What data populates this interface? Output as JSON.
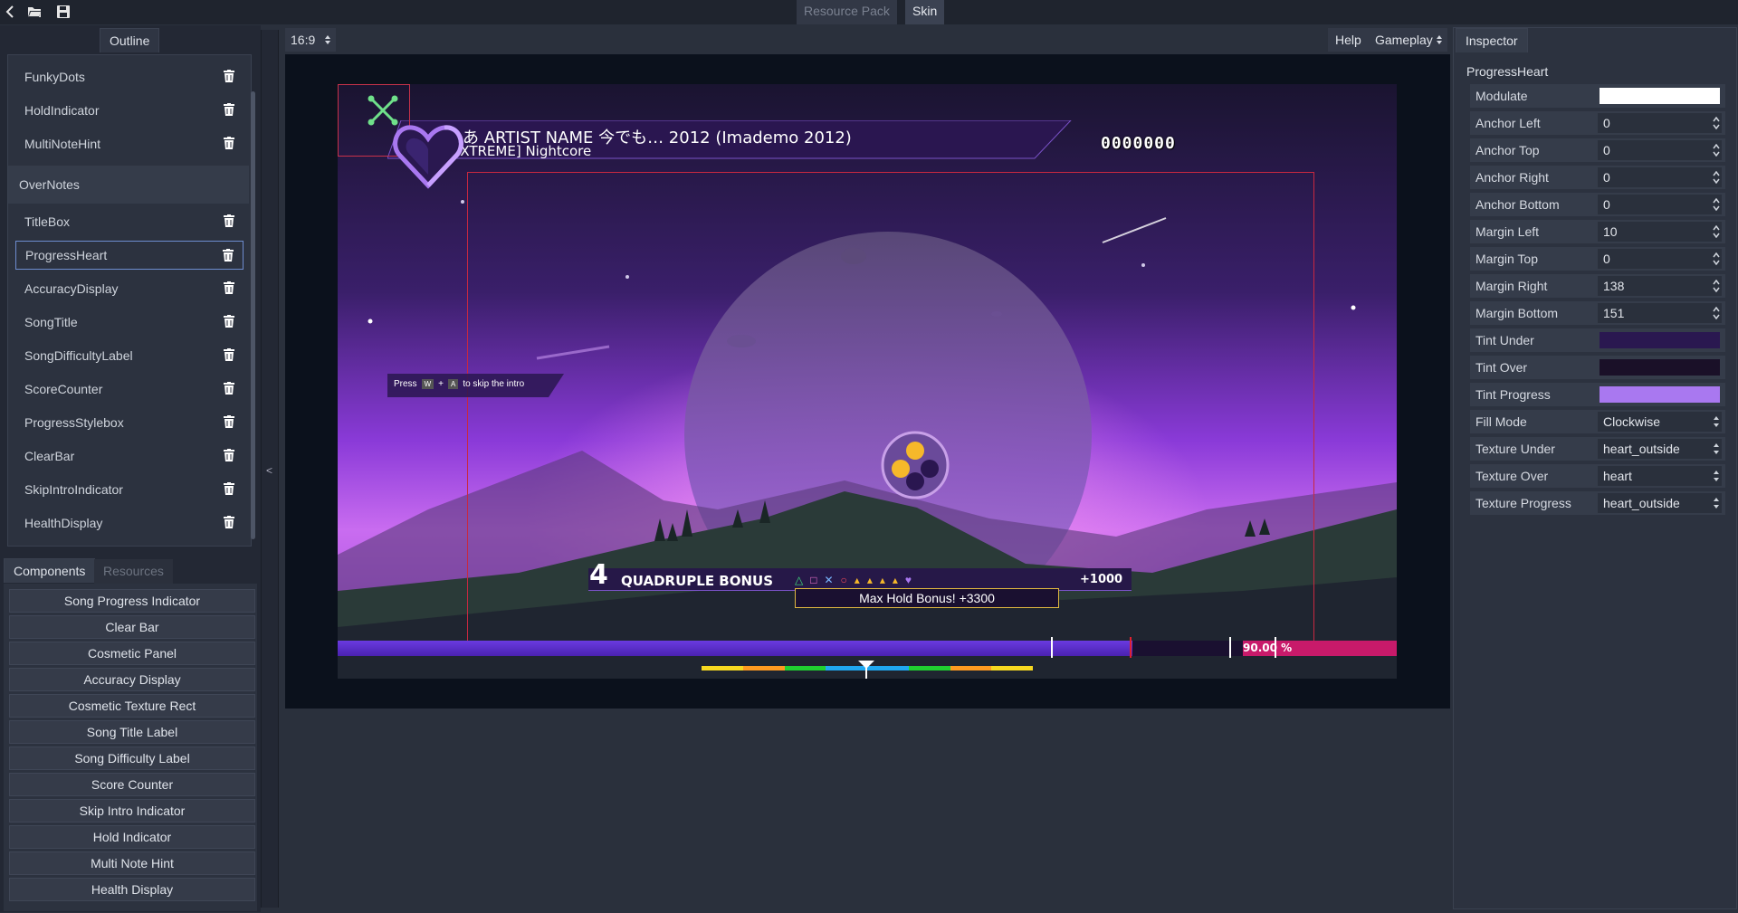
{
  "topbar": {
    "tabs": [
      "Resource Pack",
      "Skin"
    ],
    "active_tab": "Skin"
  },
  "outline": {
    "tab_label": "Outline",
    "items_top": [
      "FunkyDots",
      "HoldIndicator",
      "MultiNoteHint"
    ],
    "group_label": "OverNotes",
    "items": [
      "TitleBox",
      "ProgressHeart",
      "AccuracyDisplay",
      "SongTitle",
      "SongDifficultyLabel",
      "ScoreCounter",
      "ProgressStylebox",
      "ClearBar",
      "SkipIntroIndicator",
      "HealthDisplay"
    ],
    "selected": "ProgressHeart"
  },
  "components": {
    "tabs": [
      "Components",
      "Resources"
    ],
    "buttons": [
      "Song Progress Indicator",
      "Clear Bar",
      "Cosmetic Panel",
      "Accuracy Display",
      "Cosmetic Texture Rect",
      "Song Title Label",
      "Song Difficulty Label",
      "Score Counter",
      "Skip Intro Indicator",
      "Hold Indicator",
      "Multi Note Hint",
      "Health Display"
    ]
  },
  "divider": {
    "arrow": "<"
  },
  "viewport": {
    "ratio": "16:9",
    "help": "Help",
    "mode": "Gameplay"
  },
  "game": {
    "title": "のあ ARTIST NAME  今でも… 2012 (Imademo 2012)",
    "difficulty": "[EXTREME] Nightcore",
    "score": "0000000",
    "skip_press": "Press",
    "skip_key1": "W",
    "skip_plus": "+",
    "skip_key2": "A",
    "skip_text": "to skip the intro",
    "multiplier": "4",
    "bonus_label": "QUADRUPLE BONUS",
    "bonus_points": "+1000",
    "hold_bonus": "Max Hold Bonus! +3300",
    "progress_percent": "90.00 %",
    "progress": 0.75,
    "clear_fraction": 0.9
  },
  "inspector": {
    "tab": "Inspector",
    "node": "ProgressHeart",
    "props": [
      {
        "label": "Modulate",
        "type": "color",
        "color": "#ffffff"
      },
      {
        "label": "Anchor Left",
        "type": "num",
        "value": "0"
      },
      {
        "label": "Anchor Top",
        "type": "num",
        "value": "0"
      },
      {
        "label": "Anchor Right",
        "type": "num",
        "value": "0"
      },
      {
        "label": "Anchor Bottom",
        "type": "num",
        "value": "0"
      },
      {
        "label": "Margin Left",
        "type": "num",
        "value": "10"
      },
      {
        "label": "Margin Top",
        "type": "num",
        "value": "0"
      },
      {
        "label": "Margin Right",
        "type": "num",
        "value": "138"
      },
      {
        "label": "Margin Bottom",
        "type": "num",
        "value": "151"
      },
      {
        "label": "Tint Under",
        "type": "color",
        "color": "#2a1850"
      },
      {
        "label": "Tint Over",
        "type": "color",
        "color": "#1a1028"
      },
      {
        "label": "Tint Progress",
        "type": "color",
        "color": "#a978f0"
      },
      {
        "label": "Fill Mode",
        "type": "select",
        "value": "Clockwise"
      },
      {
        "label": "Texture Under",
        "type": "select",
        "value": "heart_outside"
      },
      {
        "label": "Texture Over",
        "type": "select",
        "value": "heart"
      },
      {
        "label": "Texture Progress",
        "type": "select",
        "value": "heart_outside"
      }
    ]
  }
}
